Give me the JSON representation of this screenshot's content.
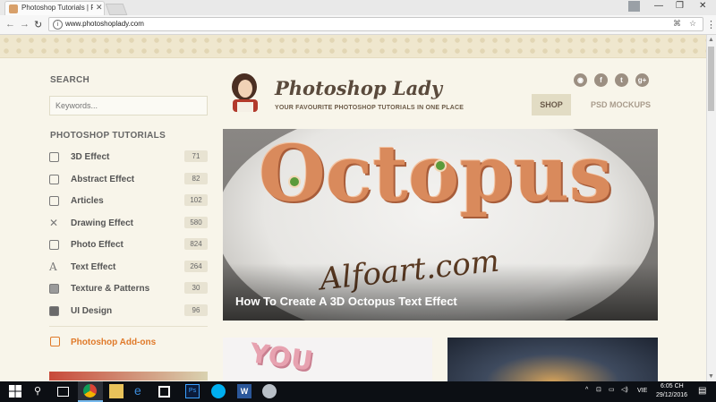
{
  "browser": {
    "tab_title": "Photoshop Tutorials | Ph",
    "url": "www.photoshoplady.com"
  },
  "site": {
    "logo": "Photoshop Lady",
    "tagline": "YOUR FAVOURITE PHOTOSHOP TUTORIALS IN ONE PLACE",
    "nav": [
      "SHOP",
      "PSD MOCKUPS"
    ]
  },
  "sidebar": {
    "search_heading": "SEARCH",
    "search_placeholder": "Keywords...",
    "tutorials_heading": "PHOTOSHOP TUTORIALS",
    "categories": [
      {
        "label": "3D Effect",
        "count": "71"
      },
      {
        "label": "Abstract Effect",
        "count": "82"
      },
      {
        "label": "Articles",
        "count": "102"
      },
      {
        "label": "Drawing Effect",
        "count": "580"
      },
      {
        "label": "Photo Effect",
        "count": "824"
      },
      {
        "label": "Text Effect",
        "count": "264"
      },
      {
        "label": "Texture & Patterns",
        "count": "30"
      },
      {
        "label": "UI Design",
        "count": "96"
      }
    ],
    "addons": "Photoshop Add-ons"
  },
  "hero": {
    "title": "How To Create A 3D Octopus Text Effect",
    "art_word": "Octopus",
    "watermark": "Alfoart.com"
  },
  "card1": {
    "art_word": "YOU"
  },
  "taskbar": {
    "time": "6:05 CH",
    "date": "29/12/2016",
    "lang": "VIE"
  },
  "colors": {
    "accent": "#e07a2a",
    "logo": "#5a4a3c",
    "page_bg": "#f8f5ea"
  }
}
